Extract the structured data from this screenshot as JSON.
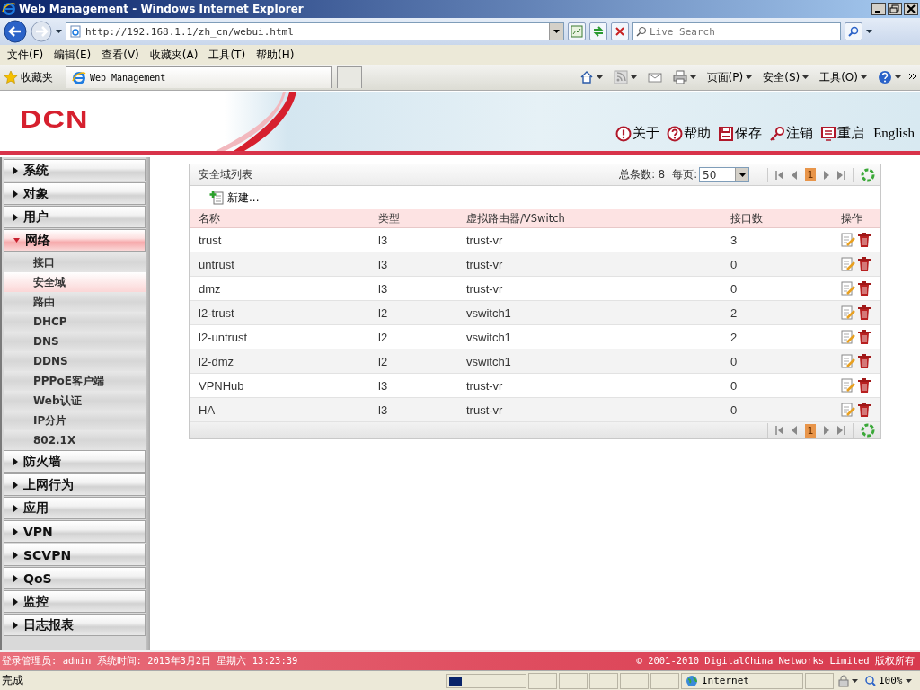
{
  "browser": {
    "title": "Web Management - Windows Internet Explorer",
    "address": "http://192.168.1.1/zh_cn/webui.html",
    "search_placeholder": "Live Search",
    "menu": [
      "文件(F)",
      "编辑(E)",
      "查看(V)",
      "收藏夹(A)",
      "工具(T)",
      "帮助(H)"
    ],
    "favorites": "收藏夹",
    "tab": "Web Management",
    "commands": [
      "页面(P)",
      "安全(S)",
      "工具(O)"
    ]
  },
  "header": {
    "logo": "DCN",
    "actions": [
      {
        "label": "关于"
      },
      {
        "label": "帮助"
      },
      {
        "label": "保存"
      },
      {
        "label": "注销"
      },
      {
        "label": "重启"
      }
    ],
    "language": "English"
  },
  "sidebar": {
    "items": [
      {
        "label": "系统",
        "expanded": false
      },
      {
        "label": "对象",
        "expanded": false
      },
      {
        "label": "用户",
        "expanded": false
      },
      {
        "label": "网络",
        "expanded": true,
        "children": [
          {
            "label": "接口",
            "selected": false
          },
          {
            "label": "安全域",
            "selected": true
          },
          {
            "label": "路由",
            "selected": false
          },
          {
            "label": "DHCP",
            "selected": false
          },
          {
            "label": "DNS",
            "selected": false
          },
          {
            "label": "DDNS",
            "selected": false
          },
          {
            "label": "PPPoE客户端",
            "selected": false
          },
          {
            "label": "Web认证",
            "selected": false
          },
          {
            "label": "IP分片",
            "selected": false
          },
          {
            "label": "802.1X",
            "selected": false
          }
        ]
      },
      {
        "label": "防火墙",
        "expanded": false
      },
      {
        "label": "上网行为",
        "expanded": false
      },
      {
        "label": "应用",
        "expanded": false
      },
      {
        "label": "VPN",
        "expanded": false
      },
      {
        "label": "SCVPN",
        "expanded": false
      },
      {
        "label": "QoS",
        "expanded": false
      },
      {
        "label": "监控",
        "expanded": false
      },
      {
        "label": "日志报表",
        "expanded": false
      }
    ]
  },
  "panel": {
    "title": "安全域列表",
    "total_label": "总条数:",
    "total": "8",
    "per_page_label": "每页:",
    "per_page": "50",
    "pages": [
      "1",
      "1"
    ],
    "new_label": "新建...",
    "columns": [
      "名称",
      "类型",
      "虚拟路由器/VSwitch",
      "接口数",
      "操作"
    ],
    "rows": [
      [
        "trust",
        "l3",
        "trust-vr",
        "3"
      ],
      [
        "untrust",
        "l3",
        "trust-vr",
        "0"
      ],
      [
        "dmz",
        "l3",
        "trust-vr",
        "0"
      ],
      [
        "l2-trust",
        "l2",
        "vswitch1",
        "2"
      ],
      [
        "l2-untrust",
        "l2",
        "vswitch1",
        "2"
      ],
      [
        "l2-dmz",
        "l2",
        "vswitch1",
        "0"
      ],
      [
        "VPNHub",
        "l3",
        "trust-vr",
        "0"
      ],
      [
        "HA",
        "l3",
        "trust-vr",
        "0"
      ]
    ]
  },
  "footer": {
    "login": "登录管理员: admin 系统时间: 2013年3月2日 星期六 13:23:39",
    "copyright": "© 2001-2010 DigitalChina Networks Limited 版权所有"
  },
  "status_bar": {
    "text": "完成",
    "zone": "Internet",
    "zoom": "100%"
  }
}
